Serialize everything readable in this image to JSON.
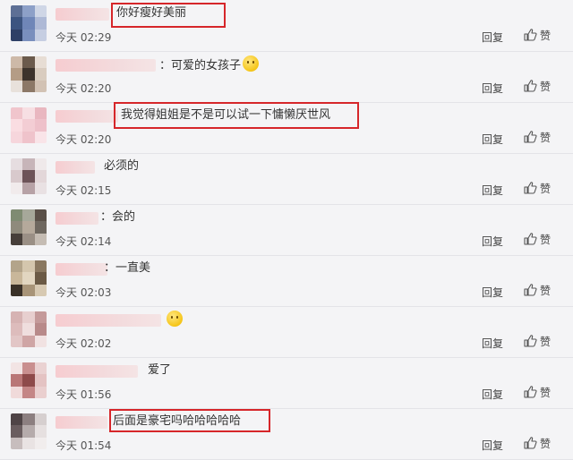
{
  "comments": [
    {
      "text": "你好瘦好美丽",
      "emoji": false,
      "time": "今天 02:29",
      "highlight": true
    },
    {
      "text": "：可爱的女孩子",
      "emoji": true,
      "time": "今天 02:20",
      "highlight": false
    },
    {
      "text": "我觉得姐姐是不是可以试一下慵懒厌世风",
      "emoji": false,
      "time": "今天 02:20",
      "highlight": true
    },
    {
      "text": "必须的",
      "emoji": false,
      "time": "今天 02:15",
      "highlight": false
    },
    {
      "text": "：会的",
      "emoji": false,
      "time": "今天 02:14",
      "highlight": false
    },
    {
      "text": "：一直美",
      "emoji": false,
      "time": "今天 02:03",
      "highlight": false
    },
    {
      "text": "",
      "emoji": true,
      "time": "今天 02:02",
      "highlight": false
    },
    {
      "text": "爱了",
      "emoji": false,
      "time": "今天 01:56",
      "highlight": false
    },
    {
      "text": "后面是豪宅吗哈哈哈哈哈",
      "emoji": false,
      "time": "今天 01:54",
      "highlight": true
    }
  ],
  "actions": {
    "reply_label": "回复",
    "like_label": "赞"
  },
  "colors": {
    "highlight_border": "#d6262a",
    "background": "#f4f4f6"
  }
}
